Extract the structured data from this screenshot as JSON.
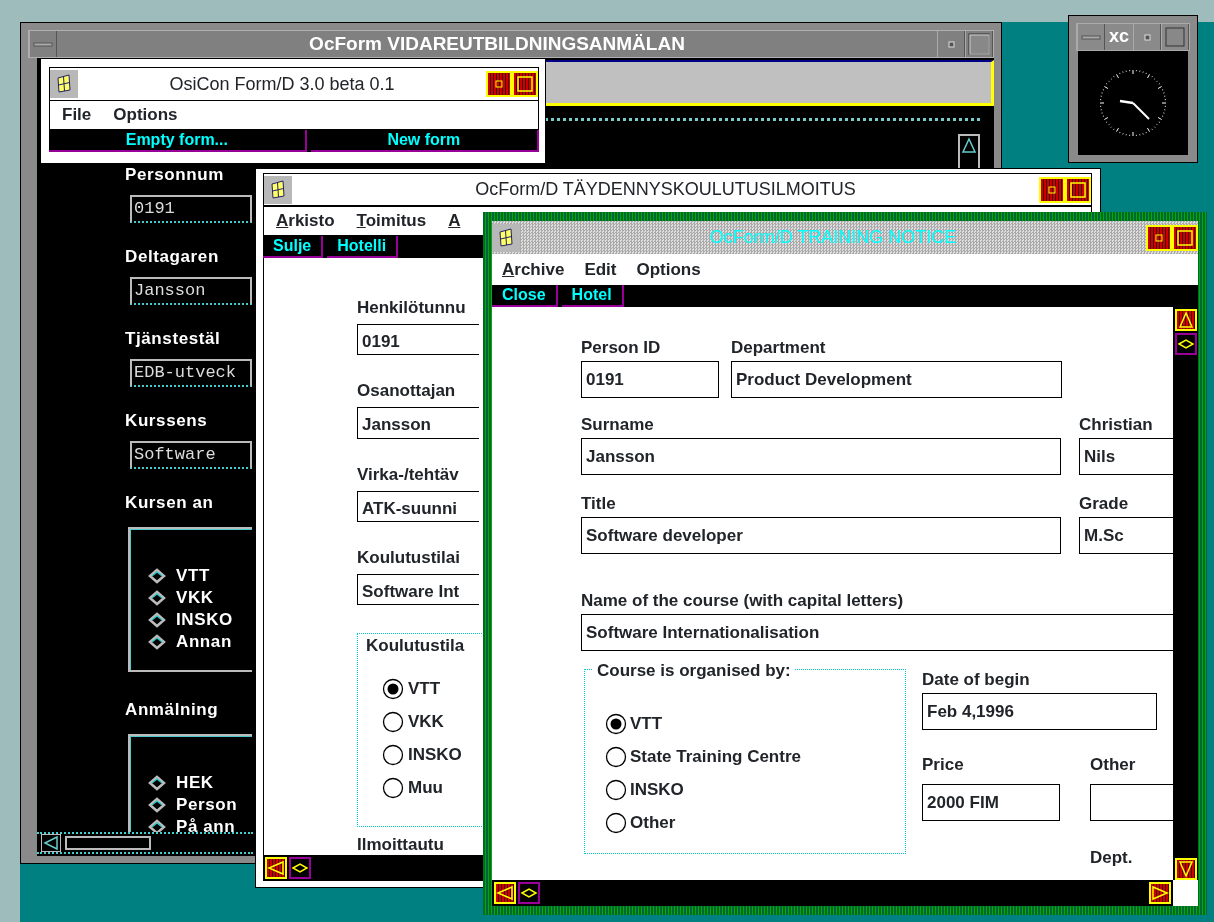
{
  "back_window": {
    "title": "OcForm VIDAREUTBILDNINGSANMÄLAN",
    "fields": [
      {
        "label": "Personnum",
        "value": "0191"
      },
      {
        "label": "Deltagaren",
        "value": "Jansson"
      },
      {
        "label": "Tjänstestäl",
        "value": "EDB-utveck"
      },
      {
        "label": "Kurssens",
        "value": "Software"
      }
    ],
    "groups": [
      {
        "label": "Kursen an",
        "options": [
          "VTT",
          "VKK",
          "INSKO",
          "Annan"
        ]
      },
      {
        "label": "Anmälning",
        "options": [
          "HEK",
          "Person",
          "På ann"
        ]
      }
    ]
  },
  "launcher_window": {
    "title": "OsiCon Form/D 3.0 beta 0.1",
    "menu": [
      {
        "label": "File",
        "mnemonic": false
      },
      {
        "label": "Options",
        "mnemonic": false
      }
    ],
    "buttons": [
      "Empty form...",
      "New form"
    ]
  },
  "clock_window": {
    "title": "xc"
  },
  "finnish_window": {
    "title": "OcForm/D TÄYDENNYSKOULUTUSILMOITUS",
    "menu": [
      {
        "label": "Arkisto",
        "mnemonic": true
      },
      {
        "label": "Toimitus",
        "mnemonic": true
      },
      {
        "label": "A",
        "mnemonic": true
      }
    ],
    "buttons": [
      "Sulje",
      "Hotelli"
    ],
    "fields": [
      {
        "label": "Henkilötunnu",
        "value": "0191"
      },
      {
        "label": "Osanottajan",
        "value": "Jansson"
      },
      {
        "label": "Virka-/tehtäv",
        "value": "ATK-suunni"
      },
      {
        "label": "Koulutustilai",
        "value": "Software Int"
      }
    ],
    "group": {
      "legend": "Koulutustila",
      "options": [
        {
          "label": "VTT",
          "selected": true
        },
        {
          "label": "VKK",
          "selected": false
        },
        {
          "label": "INSKO",
          "selected": false
        },
        {
          "label": "Muu",
          "selected": false
        }
      ]
    },
    "footer_label": "Ilmoittautu"
  },
  "english_window": {
    "title": "OcForm/D TRAINING NOTICE",
    "menu": [
      {
        "label": "Archive",
        "mnemonic": true
      },
      {
        "label": "Edit",
        "mnemonic": false
      },
      {
        "label": "Options",
        "mnemonic": false
      }
    ],
    "buttons": [
      "Close",
      "Hotel"
    ],
    "rows": [
      [
        {
          "label": "Person ID",
          "value": "0191"
        },
        {
          "label": "Department",
          "value": "Product Development"
        }
      ],
      [
        {
          "label": "Surname",
          "value": "Jansson"
        },
        {
          "label": "Christian",
          "value": "Nils"
        }
      ],
      [
        {
          "label": "Title",
          "value": "Software developer"
        },
        {
          "label": "Grade",
          "value": "M.Sc"
        }
      ],
      [
        {
          "label": "Name of the course (with capital letters)",
          "value": "Software Internationalisation"
        }
      ]
    ],
    "group": {
      "legend": "Course is organised by:",
      "options": [
        {
          "label": "VTT",
          "selected": true
        },
        {
          "label": "State Training Centre",
          "selected": false
        },
        {
          "label": "INSKO",
          "selected": false
        },
        {
          "label": "Other",
          "selected": false
        }
      ]
    },
    "date": {
      "label": "Date of begin",
      "value": "Feb 4,1996"
    },
    "price": {
      "label": "Price",
      "value": "2000 FIM"
    },
    "other": {
      "label": "Other"
    },
    "dept_label": "Dept."
  }
}
